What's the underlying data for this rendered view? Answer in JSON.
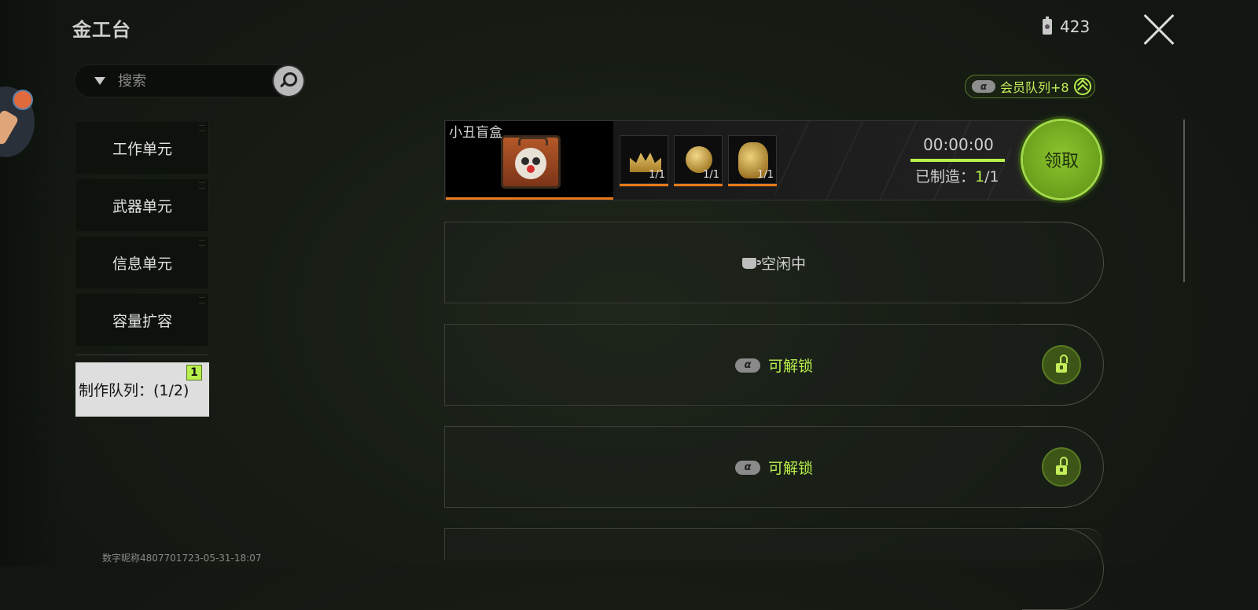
{
  "window": {
    "title": "金工台"
  },
  "currency": {
    "icon": "battery-icon",
    "amount": "423"
  },
  "search": {
    "placeholder": "搜索"
  },
  "sidebar": {
    "items": [
      {
        "label": "工作单元"
      },
      {
        "label": "武器单元"
      },
      {
        "label": "信息单元"
      },
      {
        "label": "容量扩容"
      }
    ],
    "queue_tab": {
      "label": "制作队列：(1/2)",
      "badge": "1"
    }
  },
  "vip": {
    "card_glyph": "α",
    "label": "会员队列+8"
  },
  "craft": {
    "product_name": "小丑盲盒",
    "materials": [
      {
        "icon": "gold-crown-icon",
        "count": "1/1"
      },
      {
        "icon": "gold-ball-icon",
        "count": "1/1"
      },
      {
        "icon": "gold-pot-icon",
        "count": "1/1"
      }
    ],
    "timer": "00:00:00",
    "crafted_label": "已制造：",
    "crafted_done": "1",
    "crafted_total": "/1",
    "claim_label": "领取"
  },
  "slots": [
    {
      "state": "idle",
      "label": "空闲中"
    },
    {
      "state": "locked",
      "card_glyph": "α",
      "label": "可解锁"
    },
    {
      "state": "locked",
      "card_glyph": "α",
      "label": "可解锁"
    }
  ],
  "footer": {
    "watermark": "数字昵称4807701723-05-31-18:07"
  },
  "colors": {
    "accent": "#b8ef4d",
    "progress_orange": "#e67a1c",
    "claim_green": "#7ab624"
  }
}
